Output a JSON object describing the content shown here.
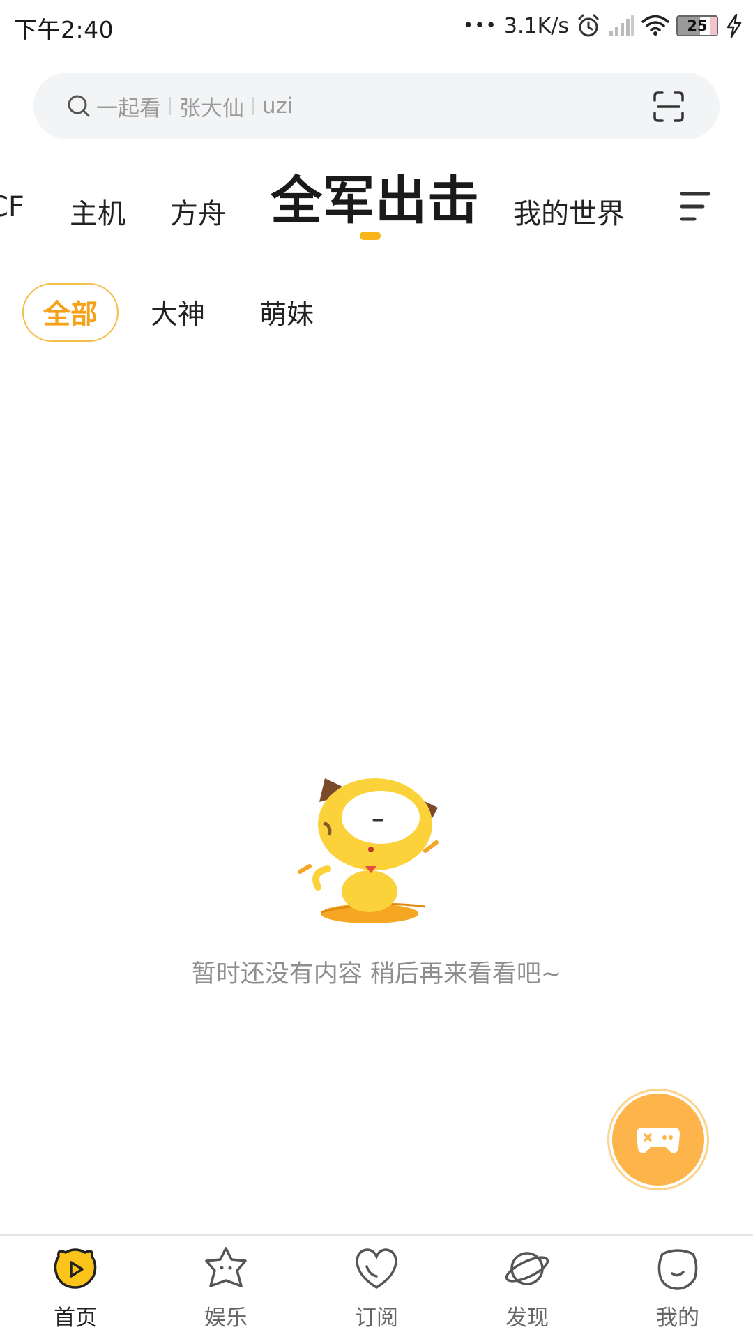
{
  "status_bar": {
    "time": "下午2:40",
    "network_speed": "3.1K/s",
    "battery_level": "25"
  },
  "search": {
    "hints": [
      "一起看",
      "张大仙",
      "uzi"
    ]
  },
  "category_tabs": {
    "items": [
      "CF",
      "主机",
      "方舟",
      "全军出击",
      "我的世界"
    ],
    "active": "全军出击"
  },
  "filter_chips": {
    "items": [
      "全部",
      "大神",
      "萌妹"
    ],
    "active": "全部"
  },
  "empty_state": {
    "message": "暂时还没有内容 稍后再来看看吧~"
  },
  "bottom_nav": {
    "items": [
      {
        "label": "首页",
        "icon": "home-cat-play-icon"
      },
      {
        "label": "娱乐",
        "icon": "star-face-icon"
      },
      {
        "label": "订阅",
        "icon": "heart-icon"
      },
      {
        "label": "发现",
        "icon": "planet-icon"
      },
      {
        "label": "我的",
        "icon": "smiley-face-icon"
      }
    ],
    "active": "首页"
  },
  "colors": {
    "accent": "#f5a21a",
    "accent_light": "#fdb54b",
    "muted_text": "#8e8e8e",
    "search_bg": "#f3f4f6"
  }
}
